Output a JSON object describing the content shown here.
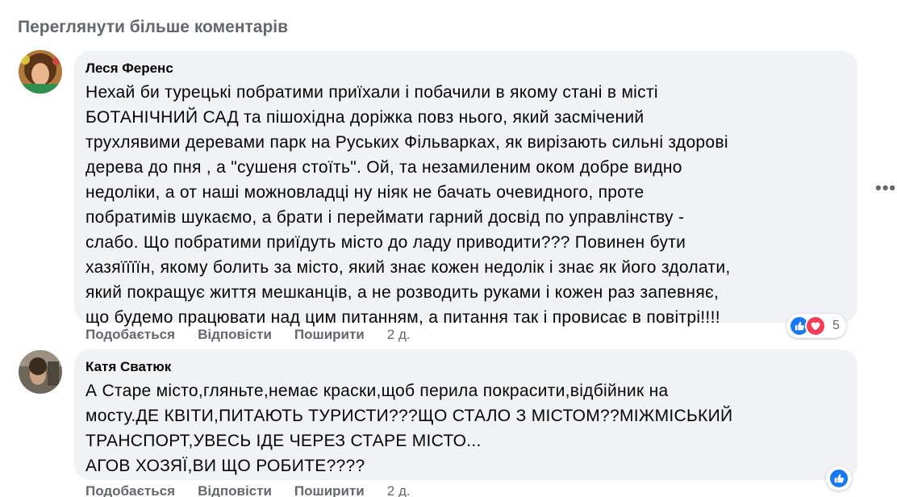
{
  "view_more_label": "Переглянути більше коментарів",
  "more_options_glyph": "•••",
  "comments": [
    {
      "author": "Леся Ференс",
      "text": "Нехай би турецькі побратими приїхали і побачили в якому стані в місті\nБОТАНІЧНИЙ САД та пішохідна доріжка повз нього, який засмічений\nтрухлявими деревами парк на Руських Фільварках, як вирізають сильні здорові\nдерева до пня , а \"сушеня стоїть\". Ой, та незамиленим оком добре видно\nнедоліки, а от наші можновладці ну ніяк не бачать очевидного, проте\nпобратимів шукаємо, а брати і переймати гарний досвід по управлінству -\nслабо. Що побратими приїдуть місто до ладу приводити??? Повинен бути\nхазяїїїїн, якому болить за місто, який знає кожен недолік і знає як його здолати,\nякий покращує життя мешканців, а не розводить руками і кожен раз запевняє,\nщо будемо працювати над цим питанням, а питання так і провисає в повітрі!!!!",
      "like_label": "Подобається",
      "reply_label": "Відповісти",
      "share_label": "Поширити",
      "time": "2 д.",
      "reaction_count": "5",
      "reactions": [
        "like-icon",
        "love-icon"
      ]
    },
    {
      "author": "Катя Сватюк",
      "text": "А Старе місто,гляньте,немає краски,щоб перила покрасити,відбійник на\nмосту.ДЕ КВІТИ,ПИТАЮТЬ ТУРИСТИ???ЩО СТАЛО З МІСТОМ??МІЖМІСЬКИЙ\nТРАНСПОРТ,УВЕСЬ ІДЕ ЧЕРЕЗ СТАРЕ МІСТО...\nАГОВ ХОЗЯЇ,ВИ ЩО РОБИТЕ????",
      "like_label": "Подобається",
      "reply_label": "Відповісти",
      "share_label": "Поширити",
      "time": "2 д.",
      "reactions": [
        "like-icon"
      ]
    }
  ],
  "colors": {
    "bubble_bg": "#f0f2f5",
    "muted_text": "#65676b",
    "like_blue": "#1877f2",
    "love_red": "#f33e58"
  }
}
